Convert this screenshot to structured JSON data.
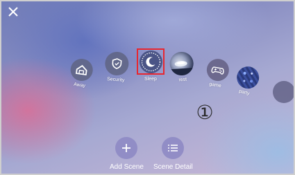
{
  "scenes": [
    {
      "label": "Away",
      "icon": "home-icon"
    },
    {
      "label": "Security",
      "icon": "shield-icon"
    },
    {
      "label": "Sleep",
      "icon": "moon-icon",
      "selected": true
    },
    {
      "label": "rest",
      "icon": "rest-photo"
    },
    {
      "label": "game",
      "icon": "gamepad-icon"
    },
    {
      "label": "party",
      "icon": "party-photo"
    },
    {
      "label": "",
      "icon": "blank-circle"
    }
  ],
  "step_marker": "①",
  "actions": {
    "add_scene": {
      "label": "Add Scene",
      "icon": "plus-icon"
    },
    "scene_detail": {
      "label": "Scene Detail",
      "icon": "list-icon"
    }
  },
  "colors": {
    "highlight": "#e8262f",
    "action_button": "#8c87c3"
  }
}
